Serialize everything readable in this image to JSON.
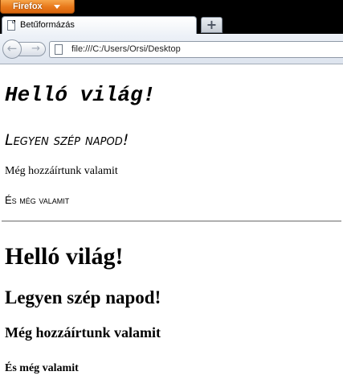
{
  "browser": {
    "menu_button_label": "Firefox",
    "tab_title": "Betűformázás",
    "new_tab_label": "+",
    "back_glyph": "←",
    "forward_glyph": "→",
    "url": "file:///C:/Users/Orsi/Desktop"
  },
  "page": {
    "heading_mono": "Helló világ!",
    "heading_smallcaps": "Legyen szép napod!",
    "paragraph": "Még hozzáírtunk valamit",
    "paragraph_smallcaps": "És még valamit",
    "h1": "Helló világ!",
    "h2": "Legyen szép napod!",
    "h3": "Még hozzáírtunk valamit",
    "h4": "És még valamit"
  }
}
